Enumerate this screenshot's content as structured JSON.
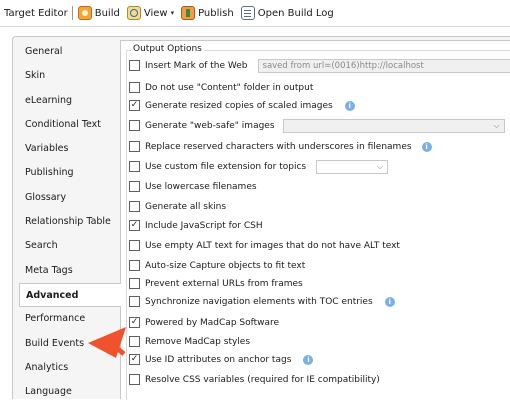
{
  "toolbar": {
    "title": "Target Editor",
    "build": "Build",
    "view": "View",
    "publish": "Publish",
    "open_log": "Open Build Log"
  },
  "sidebar": {
    "items": [
      {
        "label": "General",
        "active": false
      },
      {
        "label": "Skin",
        "active": false
      },
      {
        "label": "eLearning",
        "active": false
      },
      {
        "label": "Conditional Text",
        "active": false
      },
      {
        "label": "Variables",
        "active": false
      },
      {
        "label": "Publishing",
        "active": false
      },
      {
        "label": "Glossary",
        "active": false
      },
      {
        "label": "Relationship Table",
        "active": false
      },
      {
        "label": "Search",
        "active": false
      },
      {
        "label": "Meta Tags",
        "active": false
      },
      {
        "label": "Advanced",
        "active": true
      },
      {
        "label": "Performance",
        "active": false
      },
      {
        "label": "Build Events",
        "active": false
      },
      {
        "label": "Analytics",
        "active": false
      },
      {
        "label": "Language",
        "active": false
      }
    ]
  },
  "output_options": {
    "legend": "Output Options",
    "mark_of_web_value": "saved from url=(0016)http://localhost",
    "options": [
      {
        "label": "Insert Mark of the Web",
        "checked": false
      },
      {
        "label": "Do not use \"Content\" folder in output",
        "checked": false
      },
      {
        "label": "Generate resized copies of scaled images",
        "checked": true
      },
      {
        "label": "Generate \"web-safe\" images",
        "checked": false
      },
      {
        "label": "Replace reserved characters with underscores in filenames",
        "checked": false
      },
      {
        "label": "Use custom file extension for topics",
        "checked": false
      },
      {
        "label": "Use lowercase filenames",
        "checked": false
      },
      {
        "label": "Generate all skins",
        "checked": false
      },
      {
        "label": "Include JavaScript for CSH",
        "checked": true
      },
      {
        "label": "Use empty ALT text for images that do not have ALT text",
        "checked": false
      },
      {
        "label": "Auto-size Capture objects to fit text",
        "checked": false
      },
      {
        "label": "Prevent external URLs from frames",
        "checked": false
      },
      {
        "label": "Synchronize navigation elements with TOC entries",
        "checked": false
      },
      {
        "label": "Powered by MadCap Software",
        "checked": true
      },
      {
        "label": "Remove MadCap styles",
        "checked": false
      },
      {
        "label": "Use ID attributes on anchor tags",
        "checked": true
      },
      {
        "label": "Resolve CSS variables (required for IE compatibility)",
        "checked": false
      }
    ]
  },
  "glyphs": {
    "check": "✓",
    "info": "i",
    "chevron": "⌵",
    "caret": "▾"
  },
  "colors": {
    "arrow": "#f0522d",
    "info": "#7ab0e6"
  }
}
